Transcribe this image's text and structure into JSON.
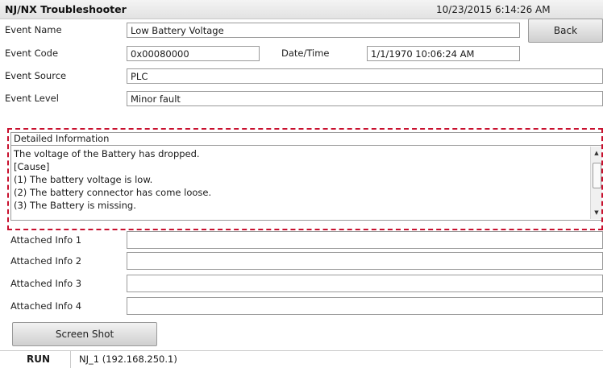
{
  "window": {
    "title": "NJ/NX Troubleshooter",
    "datetime": "10/23/2015 6:14:26 AM"
  },
  "event": {
    "name_label": "Event Name",
    "name_value": "Low Battery Voltage",
    "back_label": "Back",
    "code_label": "Event Code",
    "code_value": "0x00080000",
    "datetime_label": "Date/Time",
    "datetime_value": "1/1/1970 10:06:24 AM",
    "source_label": "Event Source",
    "source_value": "PLC",
    "level_label": "Event Level",
    "level_value": "Minor fault"
  },
  "detail": {
    "header": "Detailed Information",
    "lines": [
      "The voltage of the Battery has dropped.",
      "[Cause]",
      "(1) The battery voltage is low.",
      "(2) The battery connector has come loose.",
      "(3) The Battery is missing."
    ]
  },
  "attached": [
    {
      "label": "Attached Info 1",
      "value": ""
    },
    {
      "label": "Attached Info 2",
      "value": ""
    },
    {
      "label": "Attached Info 3",
      "value": ""
    },
    {
      "label": "Attached Info 4",
      "value": ""
    }
  ],
  "screenshot_label": "Screen Shot",
  "status": {
    "mode": "RUN",
    "connection": "NJ_1 (192.168.250.1)"
  },
  "colors": {
    "highlight_dash": "#c8102e"
  }
}
